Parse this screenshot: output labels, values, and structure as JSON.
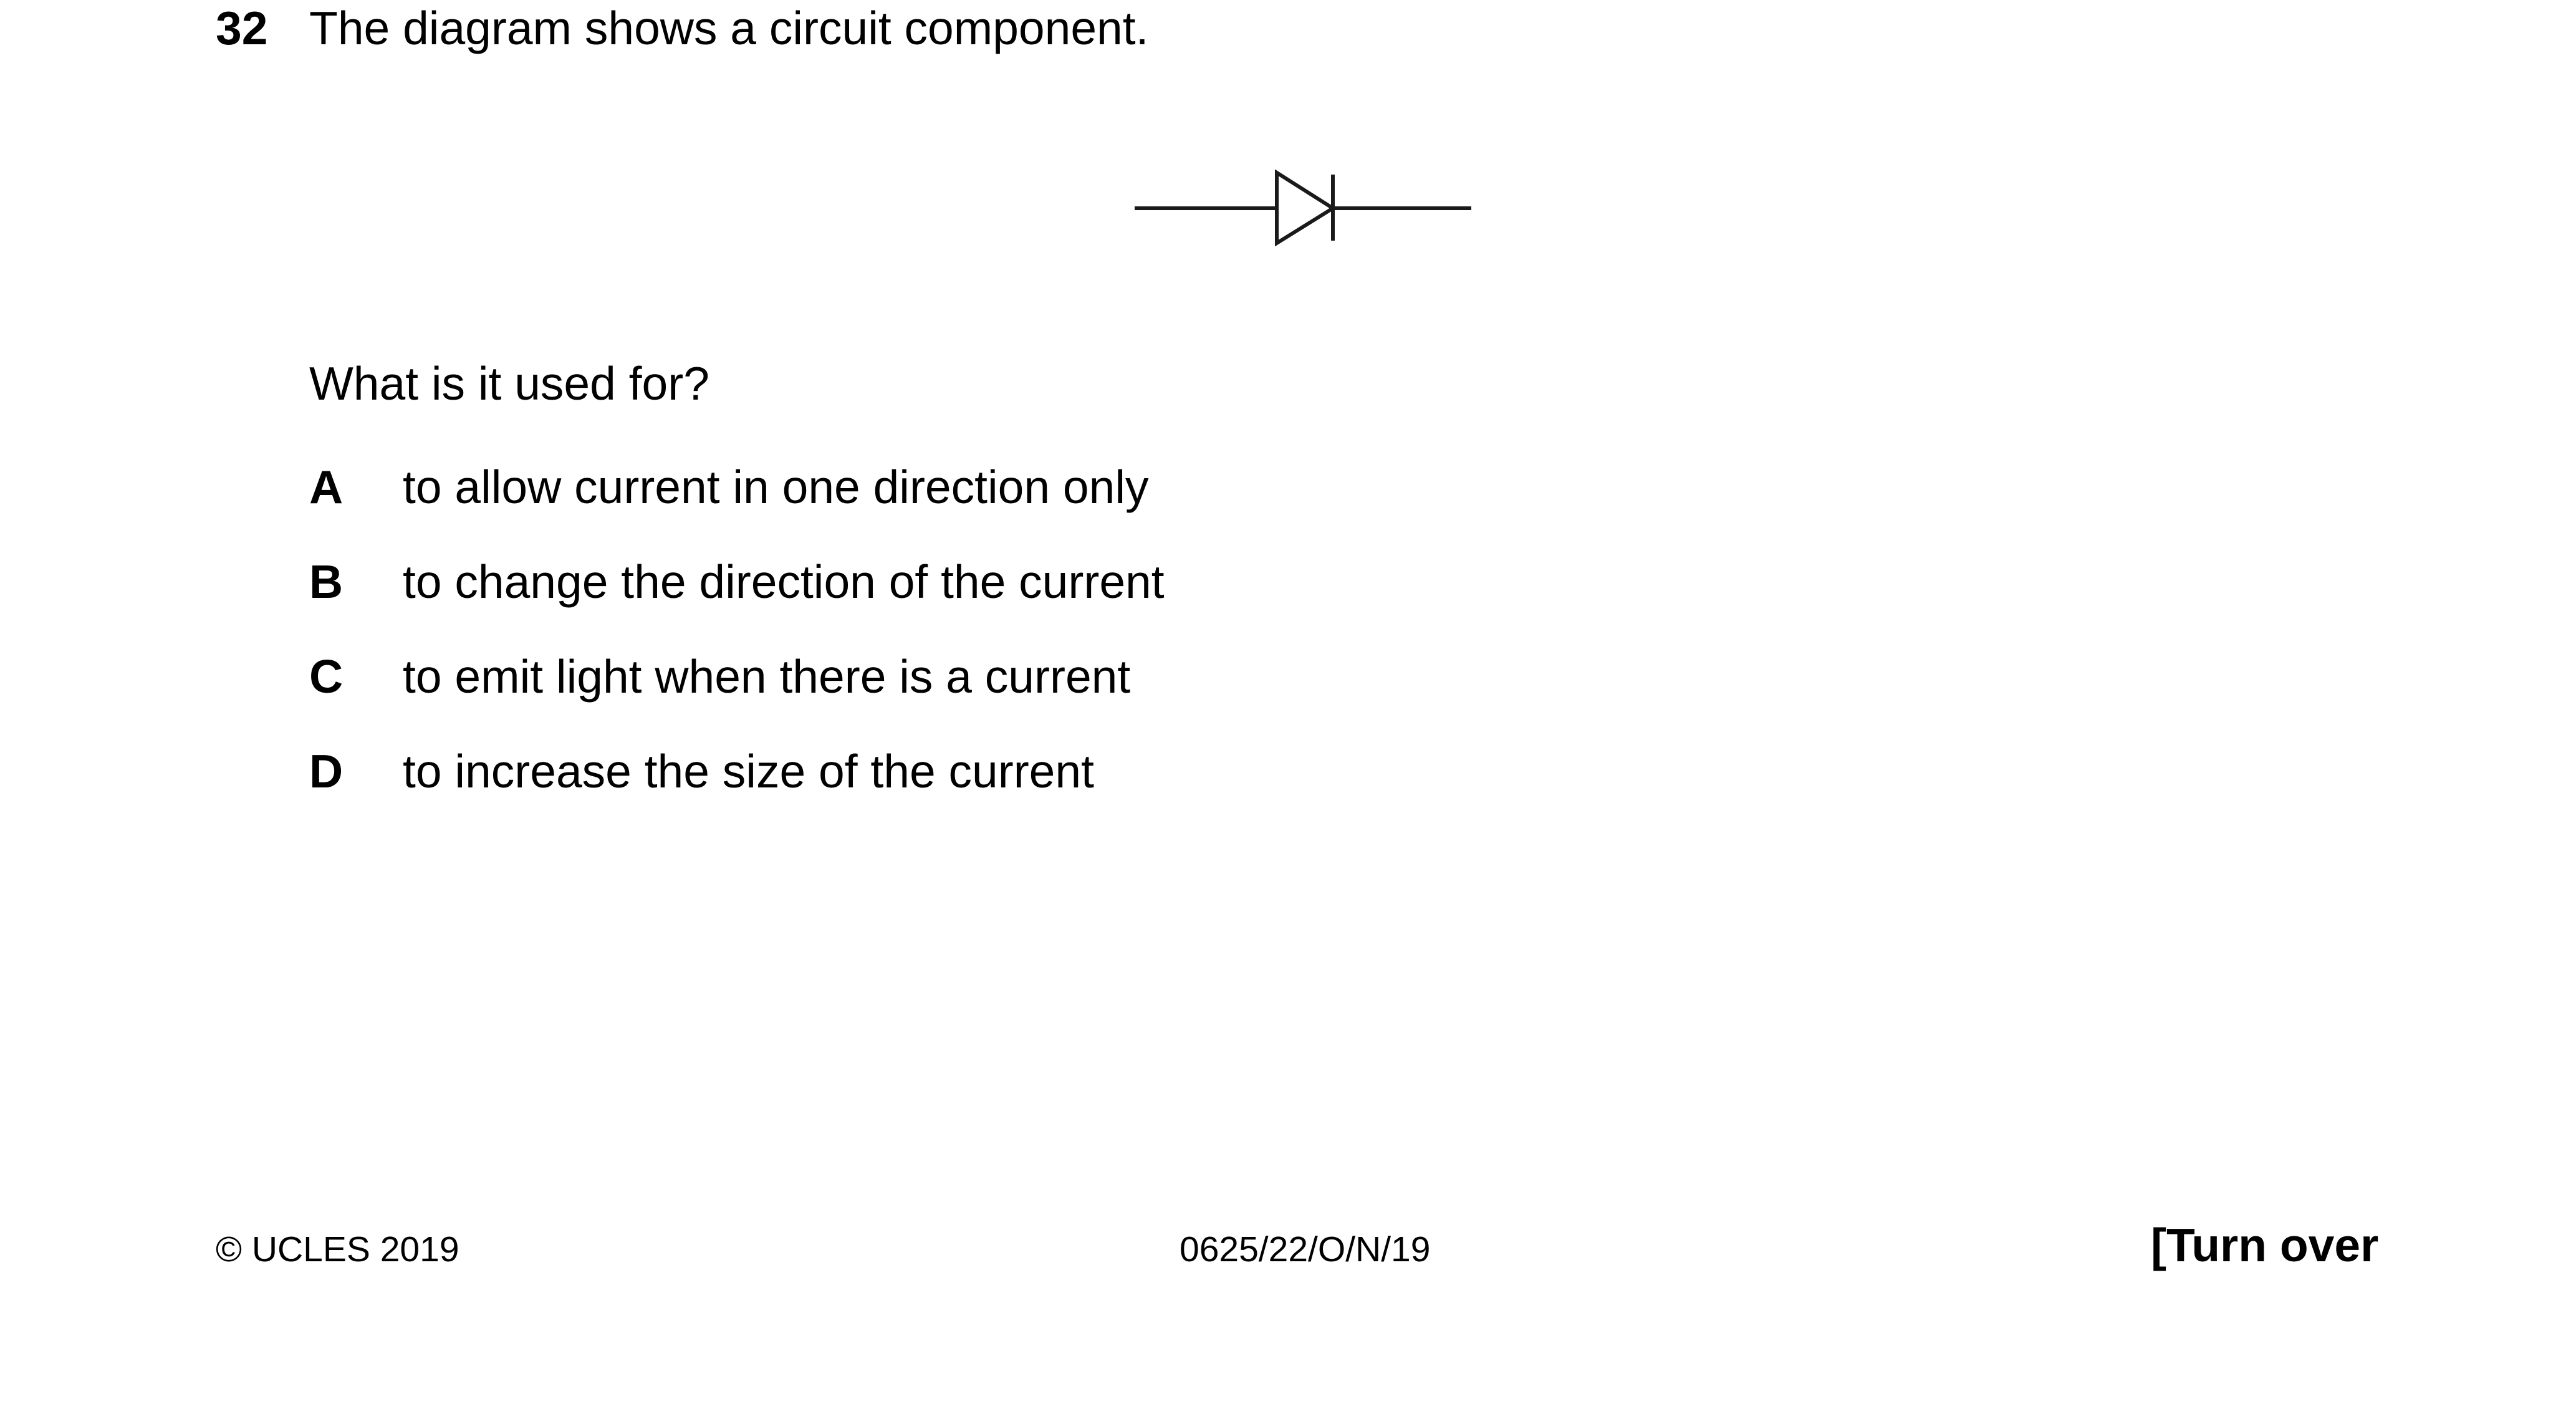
{
  "question": {
    "number": "32",
    "stem": "The diagram shows a circuit component.",
    "diagram_icon": "diode-symbol-icon",
    "prompt": "What is it used for?",
    "options": [
      {
        "letter": "A",
        "text": "to allow current in one direction only"
      },
      {
        "letter": "B",
        "text": "to change the direction of the current"
      },
      {
        "letter": "C",
        "text": "to emit light when there is a current"
      },
      {
        "letter": "D",
        "text": "to increase the size of the current"
      }
    ]
  },
  "footer": {
    "copyright": "© UCLES 2019",
    "paper_code": "0625/22/O/N/19",
    "turn_over": "[Turn over"
  }
}
